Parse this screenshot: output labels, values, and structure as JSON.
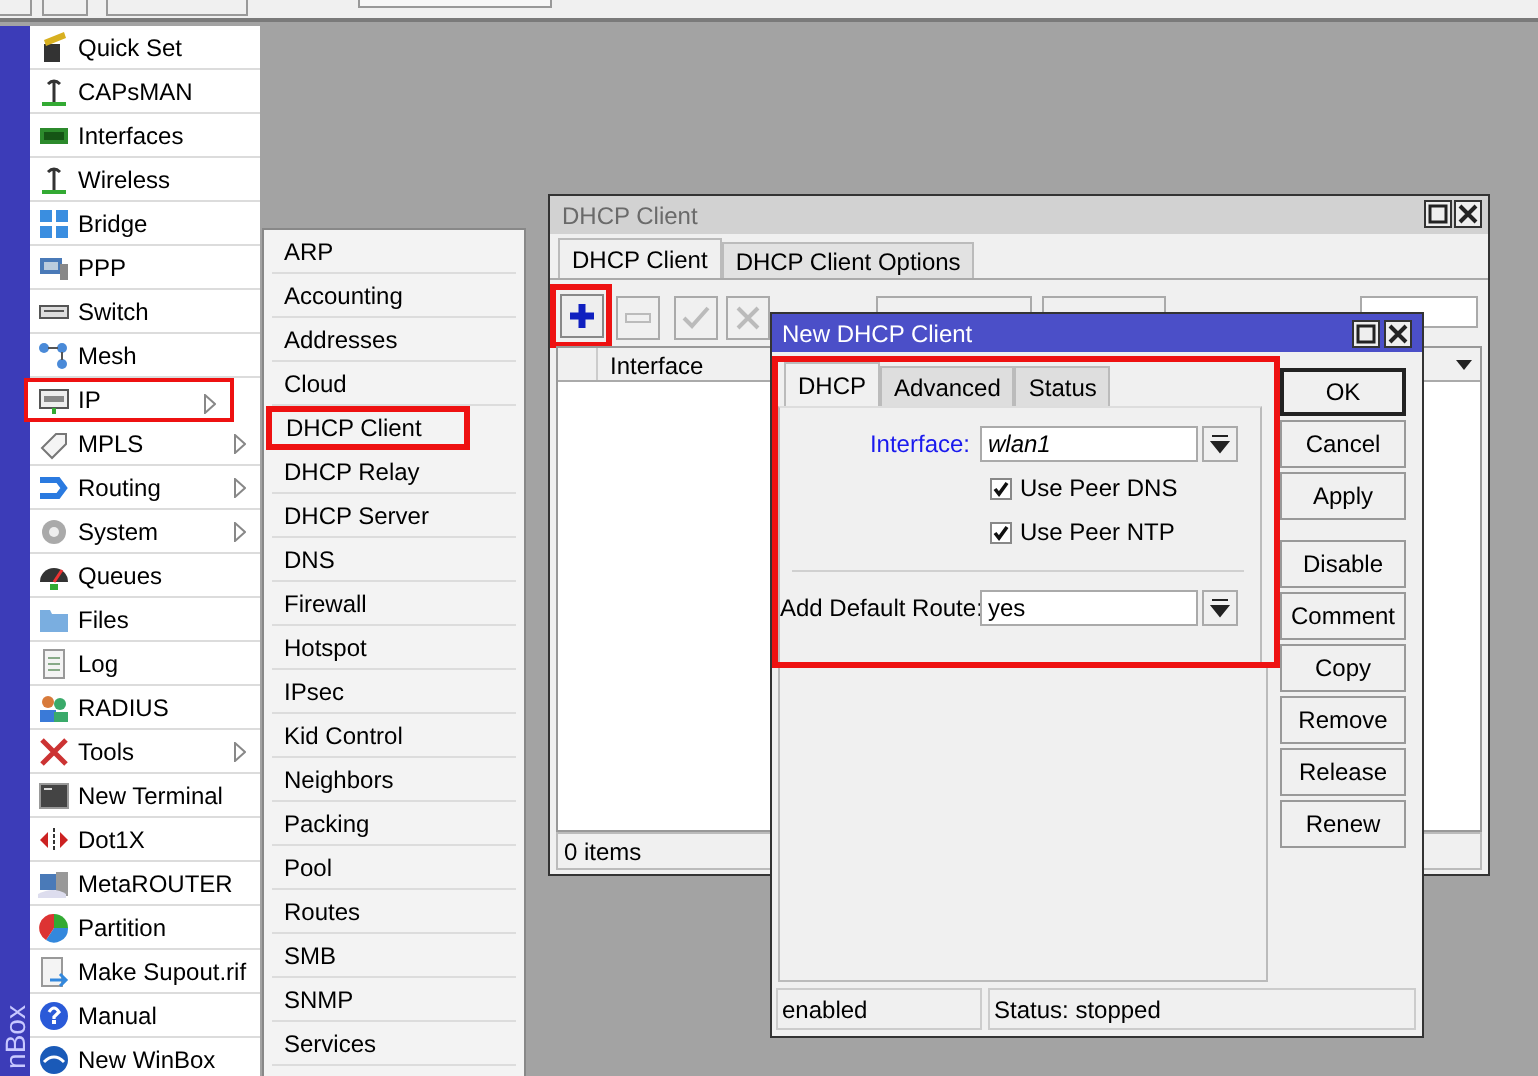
{
  "brand": "nBox",
  "main_menu": [
    {
      "label": "Quick Set",
      "has_submenu": false,
      "highlighted": false
    },
    {
      "label": "CAPsMAN",
      "has_submenu": false,
      "highlighted": false
    },
    {
      "label": "Interfaces",
      "has_submenu": false,
      "highlighted": false
    },
    {
      "label": "Wireless",
      "has_submenu": false,
      "highlighted": false
    },
    {
      "label": "Bridge",
      "has_submenu": false,
      "highlighted": false
    },
    {
      "label": "PPP",
      "has_submenu": false,
      "highlighted": false
    },
    {
      "label": "Switch",
      "has_submenu": false,
      "highlighted": false
    },
    {
      "label": "Mesh",
      "has_submenu": false,
      "highlighted": false
    },
    {
      "label": "IP",
      "has_submenu": true,
      "highlighted": true
    },
    {
      "label": "MPLS",
      "has_submenu": true,
      "highlighted": false
    },
    {
      "label": "Routing",
      "has_submenu": true,
      "highlighted": false
    },
    {
      "label": "System",
      "has_submenu": true,
      "highlighted": false
    },
    {
      "label": "Queues",
      "has_submenu": false,
      "highlighted": false
    },
    {
      "label": "Files",
      "has_submenu": false,
      "highlighted": false
    },
    {
      "label": "Log",
      "has_submenu": false,
      "highlighted": false
    },
    {
      "label": "RADIUS",
      "has_submenu": false,
      "highlighted": false
    },
    {
      "label": "Tools",
      "has_submenu": true,
      "highlighted": false
    },
    {
      "label": "New Terminal",
      "has_submenu": false,
      "highlighted": false
    },
    {
      "label": "Dot1X",
      "has_submenu": false,
      "highlighted": false
    },
    {
      "label": "MetaROUTER",
      "has_submenu": false,
      "highlighted": false
    },
    {
      "label": "Partition",
      "has_submenu": false,
      "highlighted": false
    },
    {
      "label": "Make Supout.rif",
      "has_submenu": false,
      "highlighted": false
    },
    {
      "label": "Manual",
      "has_submenu": false,
      "highlighted": false
    },
    {
      "label": "New WinBox",
      "has_submenu": false,
      "highlighted": false
    }
  ],
  "ip_submenu": [
    {
      "label": "ARP",
      "highlighted": false
    },
    {
      "label": "Accounting",
      "highlighted": false
    },
    {
      "label": "Addresses",
      "highlighted": false
    },
    {
      "label": "Cloud",
      "highlighted": false
    },
    {
      "label": "DHCP Client",
      "highlighted": true
    },
    {
      "label": "DHCP Relay",
      "highlighted": false
    },
    {
      "label": "DHCP Server",
      "highlighted": false
    },
    {
      "label": "DNS",
      "highlighted": false
    },
    {
      "label": "Firewall",
      "highlighted": false
    },
    {
      "label": "Hotspot",
      "highlighted": false
    },
    {
      "label": "IPsec",
      "highlighted": false
    },
    {
      "label": "Kid Control",
      "highlighted": false
    },
    {
      "label": "Neighbors",
      "highlighted": false
    },
    {
      "label": "Packing",
      "highlighted": false
    },
    {
      "label": "Pool",
      "highlighted": false
    },
    {
      "label": "Routes",
      "highlighted": false
    },
    {
      "label": "SMB",
      "highlighted": false
    },
    {
      "label": "SNMP",
      "highlighted": false
    },
    {
      "label": "Services",
      "highlighted": false
    }
  ],
  "dhcp_window": {
    "title": "DHCP Client",
    "tabs": [
      {
        "label": "DHCP Client",
        "selected": true
      },
      {
        "label": "DHCP Client Options",
        "selected": false
      }
    ],
    "add_button_highlighted": true,
    "table": {
      "columns": [
        "Interface"
      ]
    },
    "status": "0 items"
  },
  "dialog": {
    "title": "New DHCP Client",
    "tabs_highlighted": true,
    "tabs": [
      {
        "label": "DHCP",
        "selected": true
      },
      {
        "label": "Advanced",
        "selected": false
      },
      {
        "label": "Status",
        "selected": false
      }
    ],
    "fields": [
      {
        "kind": "select",
        "label": "Interface:",
        "value": "wlan1",
        "emphasized": true
      },
      {
        "kind": "checkbox",
        "label": "Use Peer DNS",
        "checked": true
      },
      {
        "kind": "checkbox",
        "label": "Use Peer NTP",
        "checked": true
      },
      {
        "kind": "separator"
      },
      {
        "kind": "select",
        "label": "Add Default Route:",
        "value": "yes",
        "emphasized": false
      }
    ],
    "buttons": [
      {
        "label": "OK",
        "default": true
      },
      {
        "label": "Cancel",
        "default": false
      },
      {
        "label": "Apply",
        "default": false
      },
      {
        "label": "Disable",
        "default": false
      },
      {
        "label": "Comment",
        "default": false
      },
      {
        "label": "Copy",
        "default": false
      },
      {
        "label": "Remove",
        "default": false
      },
      {
        "label": "Release",
        "default": false
      },
      {
        "label": "Renew",
        "default": false
      }
    ],
    "status_bar": [
      "enabled",
      "Status: stopped"
    ]
  }
}
